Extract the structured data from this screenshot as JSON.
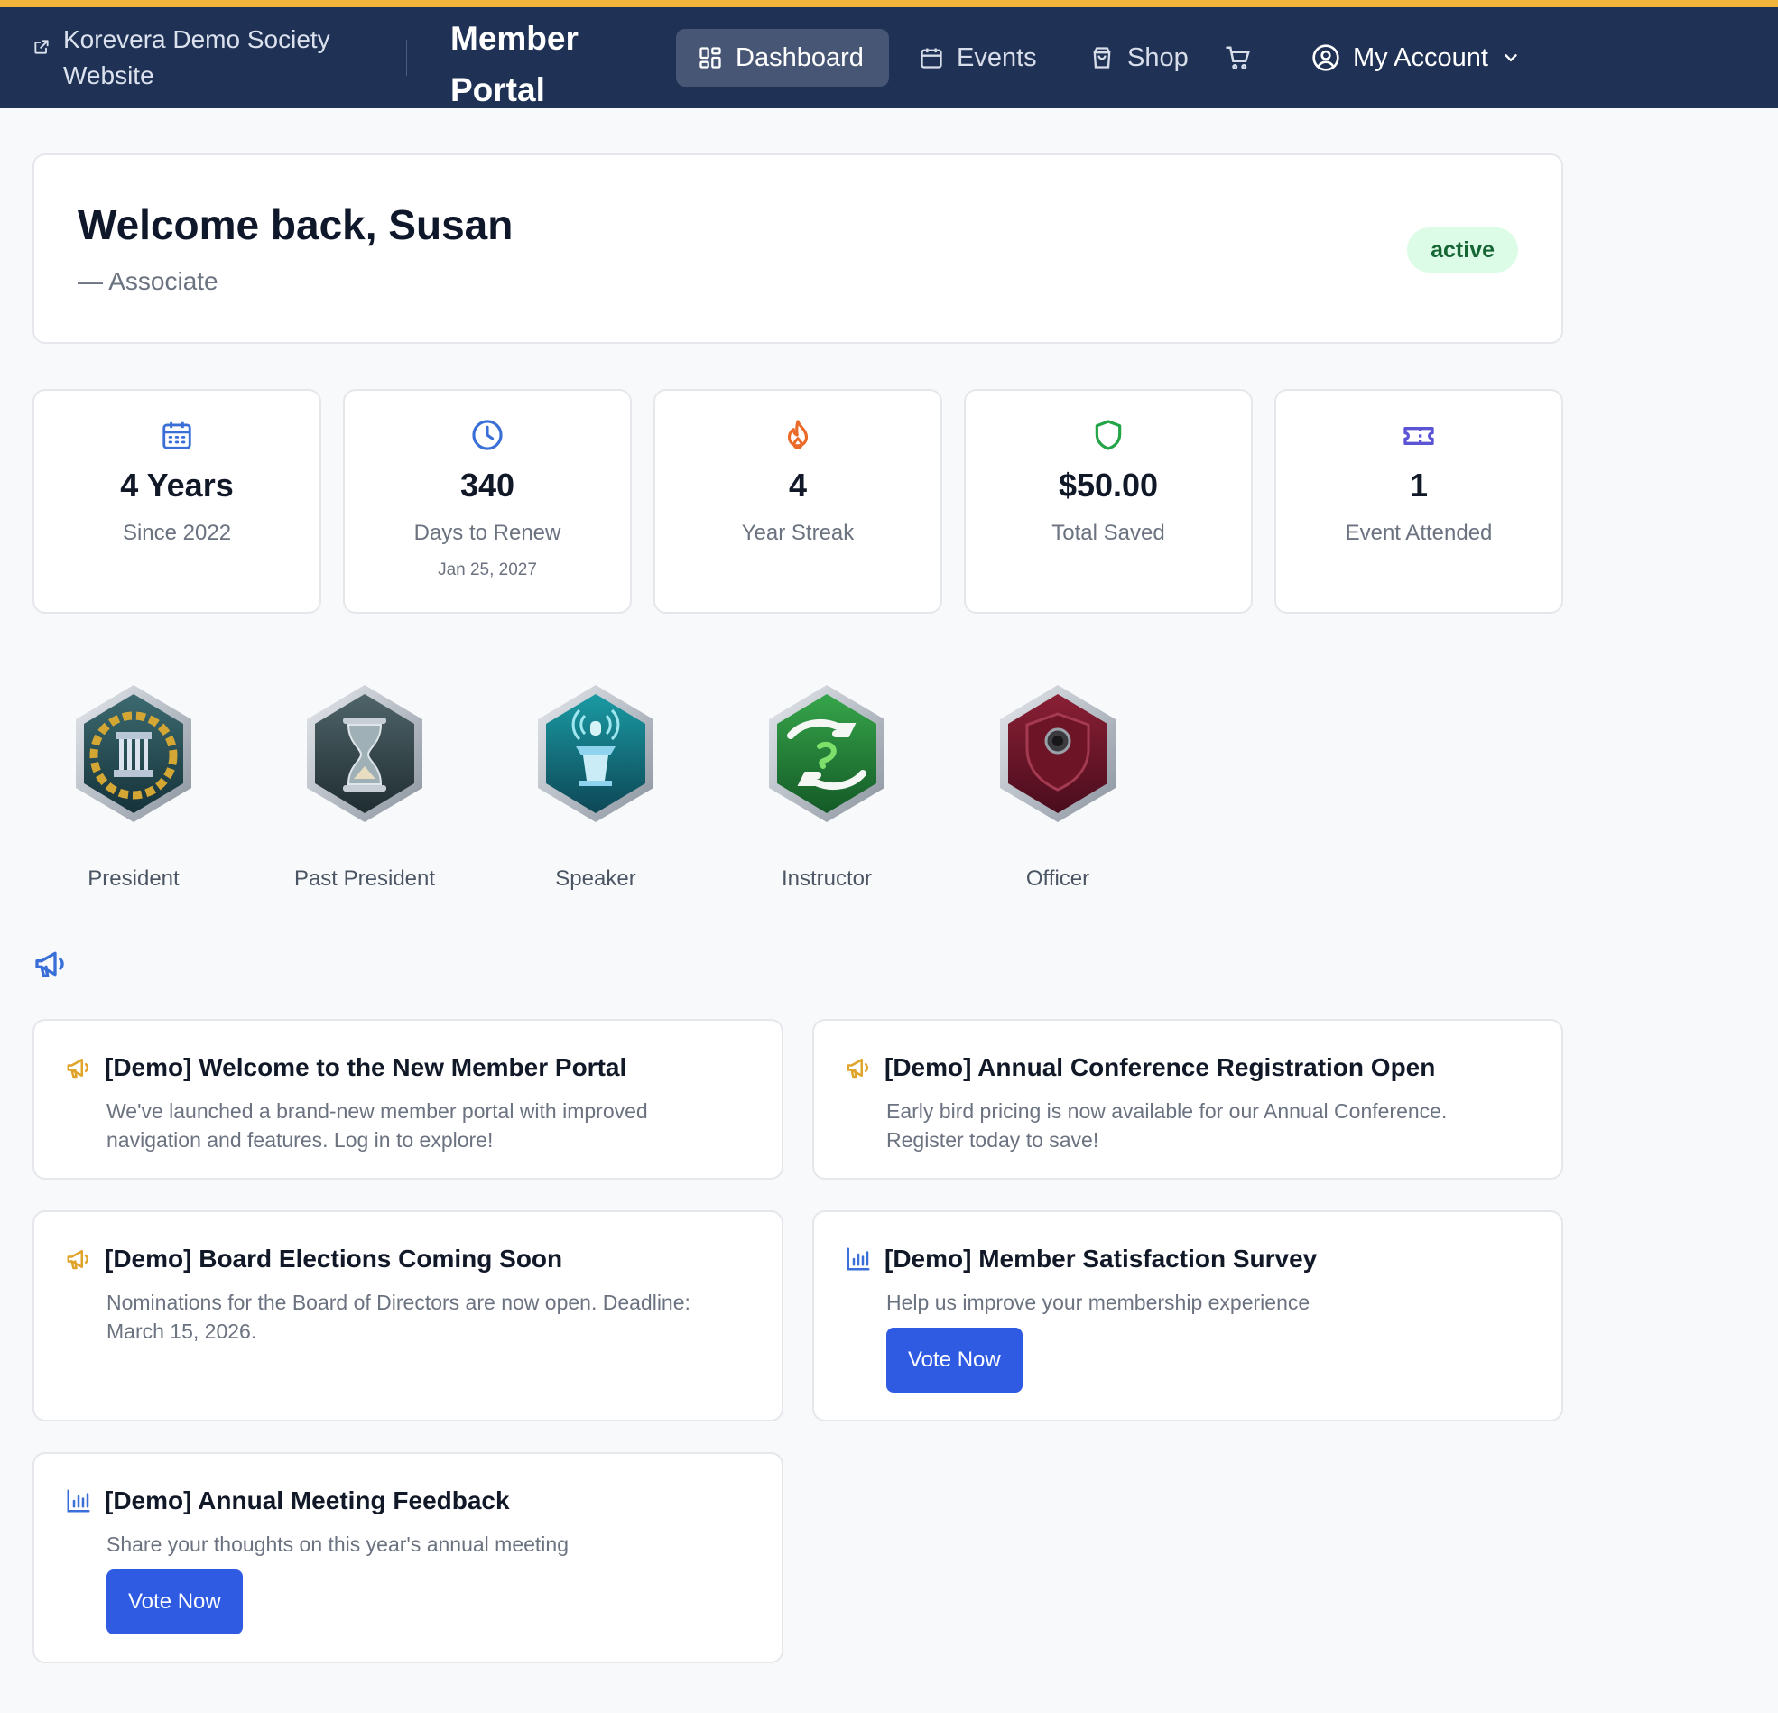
{
  "nav": {
    "site_link": "Korevera Demo Society Website",
    "portal_title": "Member Portal",
    "items": [
      {
        "label": "Dashboard",
        "icon": "dashboard-grid-icon"
      },
      {
        "label": "Events",
        "icon": "calendar-icon"
      },
      {
        "label": "Shop",
        "icon": "shopping-bag-icon"
      },
      {
        "label": "",
        "icon": "cart-icon"
      },
      {
        "label": "My Account",
        "icon": "user-circle-icon"
      }
    ]
  },
  "welcome": {
    "title": "Welcome back, Susan",
    "role": "— Associate",
    "status": "active"
  },
  "stats": [
    {
      "value": "4 Years",
      "label": "Since 2022",
      "sub": "",
      "icon": "calendar-icon",
      "color": "#3b6fd8"
    },
    {
      "value": "340",
      "label": "Days to Renew",
      "sub": "Jan 25, 2027",
      "icon": "clock-icon",
      "color": "#3b6fd8"
    },
    {
      "value": "4",
      "label": "Year Streak",
      "sub": "",
      "icon": "flame-icon",
      "color": "#ea6a2a"
    },
    {
      "value": "$50.00",
      "label": "Total Saved",
      "sub": "",
      "icon": "shield-icon",
      "color": "#22a447"
    },
    {
      "value": "1",
      "label": "Event Attended",
      "sub": "",
      "icon": "ticket-icon",
      "color": "#5b55d6"
    }
  ],
  "badges": [
    {
      "label": "President",
      "icon": "column-laurel-icon"
    },
    {
      "label": "Past President",
      "icon": "hourglass-icon"
    },
    {
      "label": "Speaker",
      "icon": "podium-icon"
    },
    {
      "label": "Instructor",
      "icon": "hands-icon"
    },
    {
      "label": "Officer",
      "icon": "shield-icon"
    }
  ],
  "announcements": [
    {
      "title": "[Demo] Welcome to the New Member Portal",
      "body": "We've launched a brand-new member portal with improved navigation and features. Log in to explore!",
      "icon": "megaphone-icon",
      "button": ""
    },
    {
      "title": "[Demo] Annual Conference Registration Open",
      "body": "Early bird pricing is now available for our Annual Conference. Register today to save!",
      "icon": "megaphone-icon",
      "button": ""
    },
    {
      "title": "[Demo] Board Elections Coming Soon",
      "body": "Nominations for the Board of Directors are now open. Deadline: March 15, 2026.",
      "icon": "megaphone-icon",
      "button": ""
    },
    {
      "title": "[Demo] Member Satisfaction Survey",
      "body": "Help us improve your membership experience",
      "icon": "bar-chart-icon",
      "button": "Vote Now"
    },
    {
      "title": "[Demo] Annual Meeting Feedback",
      "body": "Share your thoughts on this year's annual meeting",
      "icon": "bar-chart-icon",
      "button": "Vote Now"
    }
  ],
  "colors": {
    "nav_bg": "#1f3155",
    "accent_strip": "#f2b53c",
    "primary_button": "#2f5be3",
    "active_badge_bg": "#dcfce7",
    "active_badge_text": "#166534"
  }
}
